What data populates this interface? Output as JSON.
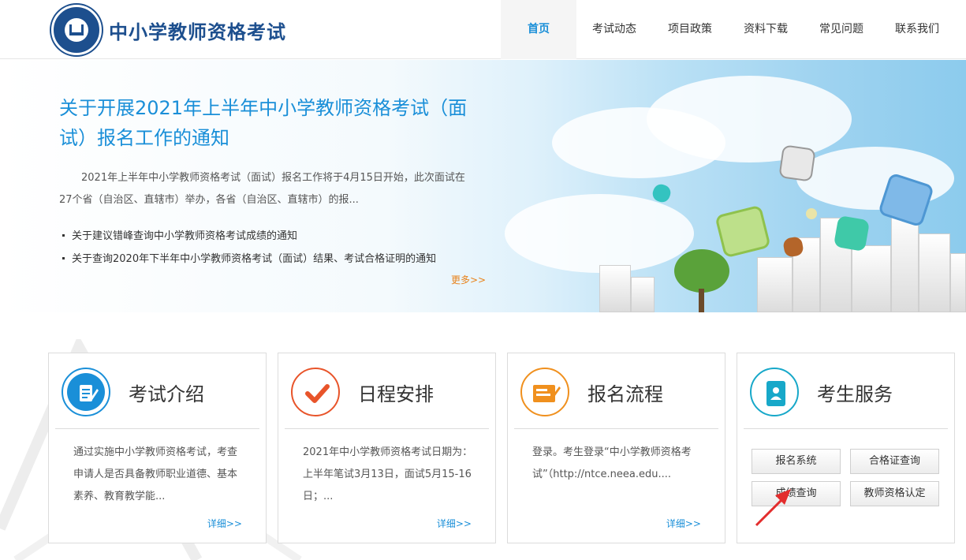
{
  "header": {
    "site_title": "中小学教师资格考试",
    "nav": [
      "首页",
      "考试动态",
      "项目政策",
      "资料下载",
      "常见问题",
      "联系我们"
    ],
    "active_nav": "首页"
  },
  "banner": {
    "title": "关于开展2021年上半年中小学教师资格考试（面试）报名工作的通知",
    "text": "2021年上半年中小学教师资格考试（面试）报名工作将于4月15日开始，此次面试在27个省（自治区、直辖市）举办，各省（自治区、直辖市）的报...",
    "news": [
      "关于建议错峰查询中小学教师资格考试成绩的通知",
      "关于查询2020年下半年中小学教师资格考试（面试）结果、考试合格证明的通知"
    ],
    "more": "更多>>"
  },
  "cards": [
    {
      "title": "考试介绍",
      "body": "通过实施中小学教师资格考试，考查申请人是否具备教师职业道德、基本素养、教育教学能...",
      "detail": "详细>>",
      "icon": "document-edit-icon",
      "color": "#1a8fd8"
    },
    {
      "title": "日程安排",
      "body": "2021年中小学教师资格考试日期为：上半年笔试3月13日，面试5月15-16日；...",
      "detail": "详细>>",
      "icon": "checkmark-icon",
      "color": "#e8542a"
    },
    {
      "title": "报名流程",
      "body": "登录。考生登录“中小学教师资格考试”（http://ntce.neea.edu....",
      "detail": "详细>>",
      "icon": "registration-form-icon",
      "color": "#f0901e"
    },
    {
      "title": "考生服务",
      "icon": "contact-book-icon",
      "color": "#17a8c9"
    }
  ],
  "services": [
    "报名系统",
    "合格证查询",
    "成绩查询",
    "教师资格认定"
  ]
}
